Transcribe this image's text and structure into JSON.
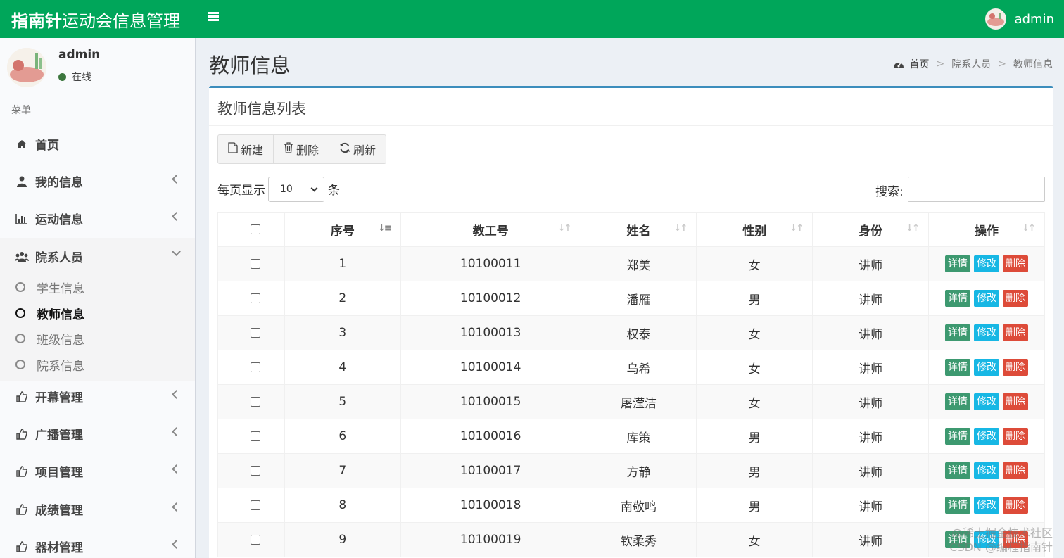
{
  "header": {
    "brand_bold": "指南针",
    "brand_rest": "运动会信息管理",
    "username": "admin"
  },
  "sidebar": {
    "user": {
      "name": "admin",
      "status": "在线"
    },
    "menu_header": "菜单",
    "items": [
      {
        "label": "首页",
        "icon": "home-icon"
      },
      {
        "label": "我的信息",
        "icon": "user-icon"
      },
      {
        "label": "运动信息",
        "icon": "bar-chart-icon"
      },
      {
        "label": "院系人员",
        "icon": "users-icon"
      },
      {
        "label": "开幕管理",
        "icon": "thumbs-up-icon"
      },
      {
        "label": "广播管理",
        "icon": "thumbs-up-icon"
      },
      {
        "label": "项目管理",
        "icon": "thumbs-up-icon"
      },
      {
        "label": "成绩管理",
        "icon": "thumbs-up-icon"
      },
      {
        "label": "器材管理",
        "icon": "thumbs-up-icon"
      }
    ],
    "subitems": [
      "学生信息",
      "教师信息",
      "班级信息",
      "院系信息"
    ]
  },
  "page": {
    "title": "教师信息",
    "breadcrumb": [
      "首页",
      "院系人员",
      "教师信息"
    ]
  },
  "box": {
    "title": "教师信息列表",
    "buttons": {
      "new": "新建",
      "delete": "删除",
      "refresh": "刷新"
    },
    "length_prefix": "每页显示",
    "length_value": "10",
    "length_suffix": "条",
    "search_label": "搜索:"
  },
  "table": {
    "columns": [
      "序号",
      "教工号",
      "姓名",
      "性别",
      "身份",
      "操作"
    ],
    "actions": {
      "detail": "详情",
      "edit": "修改",
      "delete": "删除"
    },
    "rows": [
      {
        "no": "1",
        "id": "10100011",
        "name": "郑美",
        "gender": "女",
        "role": "讲师"
      },
      {
        "no": "2",
        "id": "10100012",
        "name": "潘雁",
        "gender": "男",
        "role": "讲师"
      },
      {
        "no": "3",
        "id": "10100013",
        "name": "权泰",
        "gender": "女",
        "role": "讲师"
      },
      {
        "no": "4",
        "id": "10100014",
        "name": "乌希",
        "gender": "女",
        "role": "讲师"
      },
      {
        "no": "5",
        "id": "10100015",
        "name": "屠滢洁",
        "gender": "女",
        "role": "讲师"
      },
      {
        "no": "6",
        "id": "10100016",
        "name": "库策",
        "gender": "男",
        "role": "讲师"
      },
      {
        "no": "7",
        "id": "10100017",
        "name": "方静",
        "gender": "男",
        "role": "讲师"
      },
      {
        "no": "8",
        "id": "10100018",
        "name": "南敬鸣",
        "gender": "男",
        "role": "讲师"
      },
      {
        "no": "9",
        "id": "10100019",
        "name": "钦柔秀",
        "gender": "女",
        "role": "讲师"
      }
    ]
  },
  "watermark": [
    "@稀土掘金技术社区",
    "CSDN @编程指南针"
  ]
}
